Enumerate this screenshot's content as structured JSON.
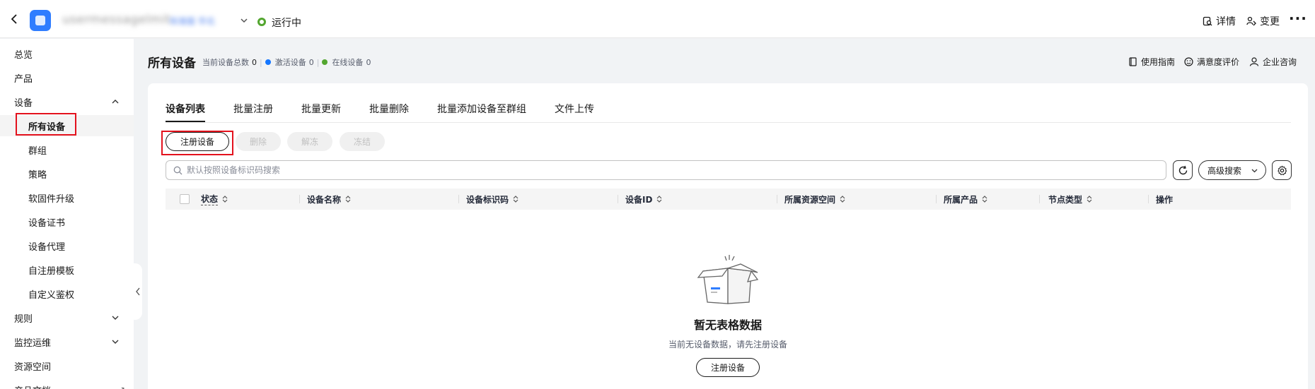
{
  "topbar": {
    "instance_name": "usermessagelmit",
    "instance_sub": "标准版 华北",
    "status": "运行中",
    "details_label": "详情",
    "change_label": "变更",
    "more_label": "···"
  },
  "sidebar": {
    "items": [
      {
        "label": "总览"
      },
      {
        "label": "产品"
      },
      {
        "label": "设备"
      },
      {
        "label": "所有设备"
      },
      {
        "label": "群组"
      },
      {
        "label": "策略"
      },
      {
        "label": "软固件升级"
      },
      {
        "label": "设备证书"
      },
      {
        "label": "设备代理"
      },
      {
        "label": "自注册模板"
      },
      {
        "label": "自定义鉴权"
      },
      {
        "label": "规则"
      },
      {
        "label": "监控运维"
      },
      {
        "label": "资源空间"
      },
      {
        "label": "产品文档"
      }
    ],
    "doc_badge": "↗"
  },
  "header": {
    "title": "所有设备",
    "total_label": "当前设备总数",
    "total_value": "0",
    "active_label": "激活设备",
    "active_value": "0",
    "online_label": "在线设备",
    "online_value": "0",
    "guide_label": "使用指南",
    "rating_label": "满意度评价",
    "consult_label": "企业咨询"
  },
  "tabs": [
    {
      "label": "设备列表"
    },
    {
      "label": "批量注册"
    },
    {
      "label": "批量更新"
    },
    {
      "label": "批量删除"
    },
    {
      "label": "批量添加设备至群组"
    },
    {
      "label": "文件上传"
    }
  ],
  "toolbar": {
    "register_label": "注册设备",
    "delete_label": "删除",
    "unfreeze_label": "解冻",
    "freeze_label": "冻结"
  },
  "search": {
    "placeholder": "默认按照设备标识码搜索",
    "value": "",
    "advanced_label": "高级搜索"
  },
  "table": {
    "columns": [
      {
        "label": "状态"
      },
      {
        "label": "设备名称"
      },
      {
        "label": "设备标识码"
      },
      {
        "label": "设备ID"
      },
      {
        "label": "所属资源空间"
      },
      {
        "label": "所属产品"
      },
      {
        "label": "节点类型"
      },
      {
        "label": "操作"
      }
    ],
    "rows": []
  },
  "empty": {
    "title": "暂无表格数据",
    "description": "当前无设备数据，请先注册设备",
    "button_label": "注册设备"
  },
  "colors": {
    "status_running": "#53a62f",
    "active_dot": "#1476ff",
    "online_dot": "#53a62f",
    "highlight": "#e3111d",
    "brand": "#2f7dff"
  }
}
